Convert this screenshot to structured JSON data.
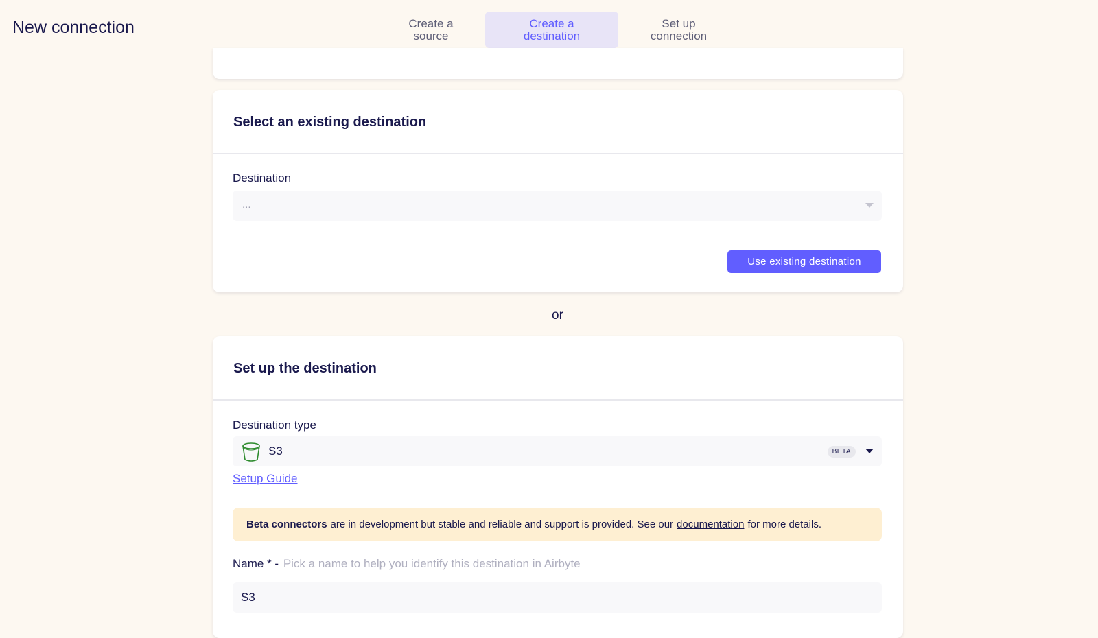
{
  "header": {
    "title": "New connection",
    "steps": [
      {
        "line1": "Create a",
        "line2": "source"
      },
      {
        "line1": "Create a",
        "line2": "destination"
      },
      {
        "line1": "Set up",
        "line2": "connection"
      }
    ]
  },
  "existing": {
    "title": "Select an existing destination",
    "field_label": "Destination",
    "select_value": "...",
    "button": "Use existing destination"
  },
  "or_label": "or",
  "setup": {
    "title": "Set up the destination",
    "type_label": "Destination type",
    "type_value": "S3",
    "type_icon": "bucket-icon",
    "badge": "BETA",
    "guide_link": "Setup Guide",
    "notice": {
      "bold": "Beta connectors",
      "text": "are in development but stable and reliable and support is provided. See our",
      "link": "documentation",
      "tail": "for more details."
    },
    "name_label": "Name * -",
    "name_hint": "Pick a name to help you identify this destination in Airbyte",
    "name_value": "S3"
  },
  "colors": {
    "accent": "#615eff",
    "background": "#fdf8f1",
    "active_step_bg": "#e8e4f7",
    "notice_bg": "#feefd2"
  }
}
